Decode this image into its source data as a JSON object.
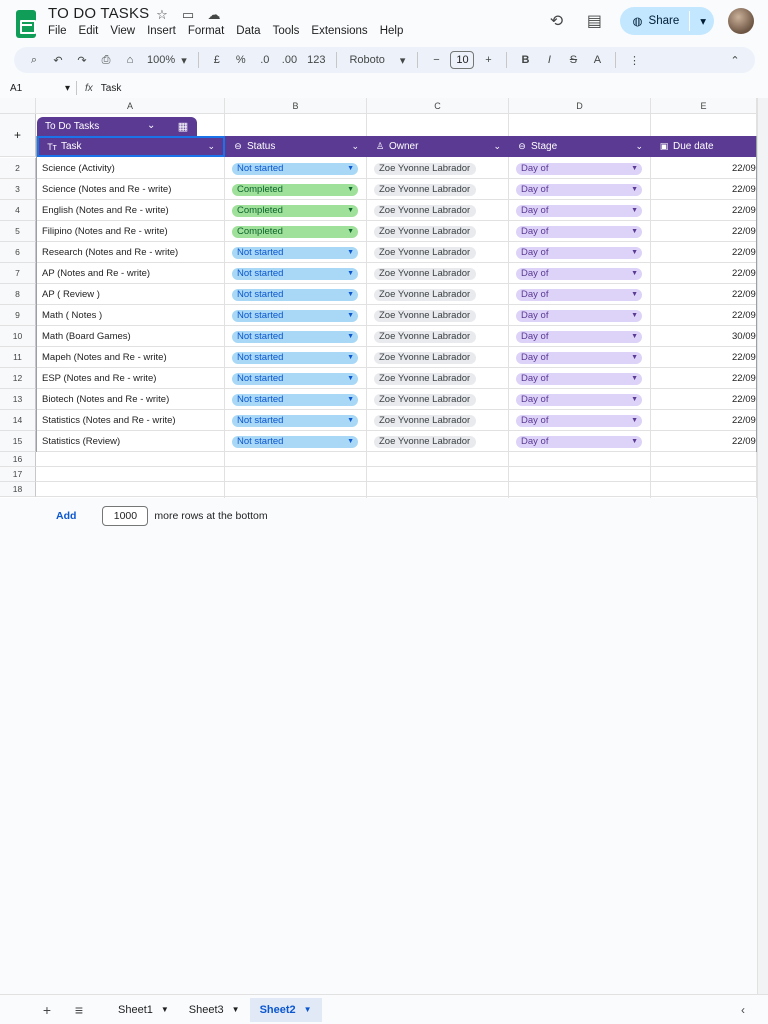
{
  "header": {
    "title": "TO DO TASKS",
    "menu": [
      "File",
      "Edit",
      "View",
      "Insert",
      "Format",
      "Data",
      "Tools",
      "Extensions",
      "Help"
    ],
    "share_label": "Share"
  },
  "toolbar": {
    "zoom": "100%",
    "currency": "£",
    "percent": "%",
    "dec_less": ".0",
    "dec_more": ".00",
    "format_123": "123",
    "font": "Roboto",
    "font_size": "10"
  },
  "formula": {
    "cell_ref": "A1",
    "fx": "fx",
    "content": "Task"
  },
  "grid": {
    "columns": [
      "A",
      "B",
      "C",
      "D",
      "E"
    ],
    "extra_rows": [
      "16",
      "17",
      "18"
    ]
  },
  "table": {
    "name": "To Do Tasks",
    "headers": {
      "task": "Task",
      "status": "Status",
      "owner": "Owner",
      "stage": "Stage",
      "due": "Due date"
    },
    "rows": [
      {
        "n": "2",
        "task": "Science (Activity)",
        "status": "Not started",
        "owner": "Zoe Yvonne Labrador",
        "stage": "Day of",
        "due": "22/09"
      },
      {
        "n": "3",
        "task": "Science (Notes and Re - write)",
        "status": "Completed",
        "owner": "Zoe Yvonne Labrador",
        "stage": "Day of",
        "due": "22/09"
      },
      {
        "n": "4",
        "task": "English (Notes and Re - write)",
        "status": "Completed",
        "owner": "Zoe Yvonne Labrador",
        "stage": "Day of",
        "due": "22/09"
      },
      {
        "n": "5",
        "task": "Filipino (Notes and Re - write)",
        "status": "Completed",
        "owner": "Zoe Yvonne Labrador",
        "stage": "Day of",
        "due": "22/09"
      },
      {
        "n": "6",
        "task": "Research (Notes and Re - write)",
        "status": "Not started",
        "owner": "Zoe Yvonne Labrador",
        "stage": "Day of",
        "due": "22/09"
      },
      {
        "n": "7",
        "task": "AP (Notes and Re - write)",
        "status": "Not started",
        "owner": "Zoe Yvonne Labrador",
        "stage": "Day of",
        "due": "22/09"
      },
      {
        "n": "8",
        "task": "AP ( Review )",
        "status": "Not started",
        "owner": "Zoe Yvonne Labrador",
        "stage": "Day of",
        "due": "22/09"
      },
      {
        "n": "9",
        "task": "Math ( Notes )",
        "status": "Not started",
        "owner": "Zoe Yvonne Labrador",
        "stage": "Day of",
        "due": "22/09"
      },
      {
        "n": "10",
        "task": "Math (Board Games)",
        "status": "Not started",
        "owner": "Zoe Yvonne Labrador",
        "stage": "Day of",
        "due": "30/09"
      },
      {
        "n": "11",
        "task": "Mapeh (Notes and Re - write)",
        "status": "Not started",
        "owner": "Zoe Yvonne Labrador",
        "stage": "Day of",
        "due": "22/09"
      },
      {
        "n": "12",
        "task": "ESP (Notes and Re - write)",
        "status": "Not started",
        "owner": "Zoe Yvonne Labrador",
        "stage": "Day of",
        "due": "22/09"
      },
      {
        "n": "13",
        "task": "Biotech  (Notes and Re - write)",
        "status": "Not started",
        "owner": "Zoe Yvonne Labrador",
        "stage": "Day of",
        "due": "22/09"
      },
      {
        "n": "14",
        "task": "Statistics (Notes and Re - write)",
        "status": "Not started",
        "owner": "Zoe Yvonne Labrador",
        "stage": "Day of",
        "due": "22/09"
      },
      {
        "n": "15",
        "task": "Statistics (Review)",
        "status": "Not started",
        "owner": "Zoe Yvonne Labrador",
        "stage": "Day of",
        "due": "22/09"
      }
    ]
  },
  "add_rows": {
    "button": "Add",
    "count": "1000",
    "suffix": "more rows at the bottom"
  },
  "sheets": {
    "tabs": [
      "Sheet1",
      "Sheet3",
      "Sheet2"
    ],
    "active": "Sheet2"
  },
  "colors": {
    "accent": "#5b3a94",
    "not_started": "#a8d8f6",
    "completed": "#9fe09a",
    "stage": "#ddd2f8",
    "share": "#c2e7ff"
  }
}
